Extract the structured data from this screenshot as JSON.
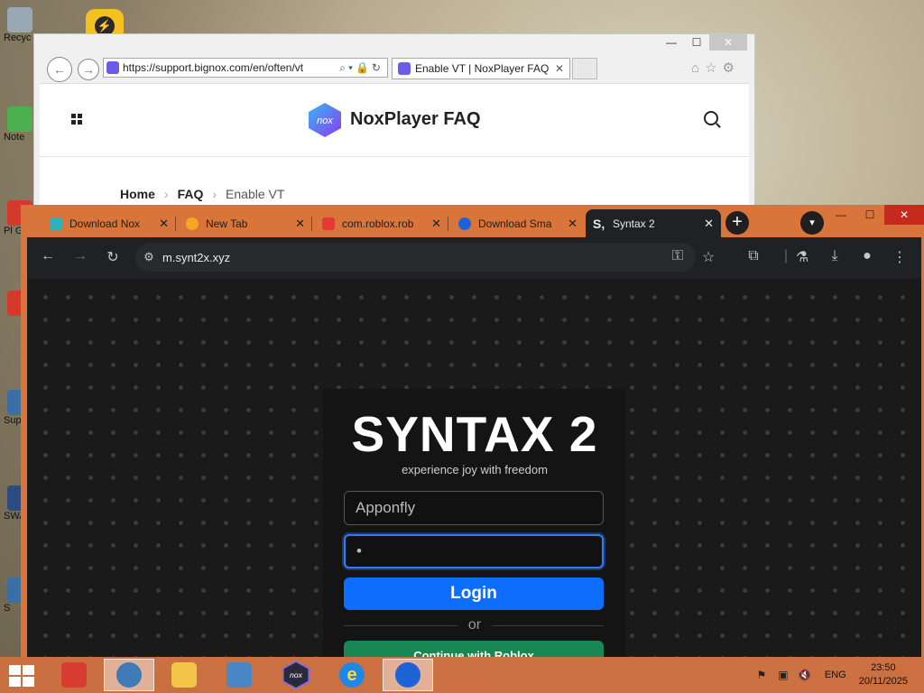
{
  "desktop": {
    "icons": [
      {
        "label": "Recyc",
        "color": "#9aa7b5"
      },
      {
        "label": "Note",
        "color": "#4caf50"
      },
      {
        "label": "Pl Gre",
        "color": "#d33a2c"
      },
      {
        "label": "",
        "color": "#d33a2c"
      },
      {
        "label": "Sup",
        "color": "#3a6ea5"
      },
      {
        "label": "SWA Stet",
        "color": "#2b4c7e"
      },
      {
        "label": "S",
        "color": "#3a6ea5"
      }
    ]
  },
  "ie": {
    "url": "https://support.bignox.com/en/often/vt",
    "tab_title": "Enable VT | NoxPlayer FAQ",
    "site_title": "NoxPlayer FAQ",
    "breadcrumbs": [
      "Home",
      "FAQ",
      "Enable VT"
    ]
  },
  "chrome": {
    "tabs": [
      {
        "title": "Download Nox",
        "favicon_color": "#2bb3c0"
      },
      {
        "title": "New Tab",
        "favicon_color": "#f5a623"
      },
      {
        "title": "com.roblox.rob",
        "favicon_color": "#e53935"
      },
      {
        "title": "Download Sma",
        "favicon_color": "#1e63d6"
      },
      {
        "title": "Syntax 2",
        "favicon_color": "#202124"
      }
    ],
    "address": "m.synt2x.xyz"
  },
  "page": {
    "title": "SYNTAX 2",
    "subtitle": "experience joy with freedom",
    "username_value": "Apponfly",
    "password_mask": "•",
    "login_label": "Login",
    "or_label": "or",
    "roblox_label": "Continue with Roblox"
  },
  "taskbar": {
    "language": "ENG",
    "time": "23:50",
    "date": "20/11/2025"
  },
  "colors": {
    "chrome_frame": "#d9753b",
    "login_blue": "#0d6efd",
    "roblox_green": "#198754"
  }
}
